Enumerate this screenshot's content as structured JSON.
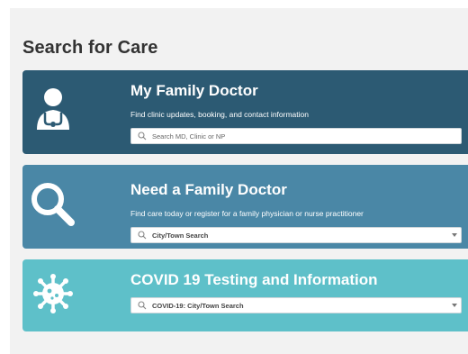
{
  "heading": "Search for Care",
  "cards": [
    {
      "title": "My Family Doctor",
      "subtitle": "Find clinic updates, booking, and contact information",
      "search_placeholder": "Search MD, Clinic or NP",
      "icon": "doctor-icon",
      "color": "#2c5a73"
    },
    {
      "title": "Need a Family Doctor",
      "subtitle": "Find care today or register for a family physician or nurse practitioner",
      "select_value": "City/Town Search",
      "icon": "magnifier-icon",
      "color": "#4a87a6"
    },
    {
      "title": "COVID 19 Testing and Information",
      "select_value": "COVID-19: City/Town Search",
      "icon": "virus-icon",
      "color": "#5ec0c9"
    }
  ]
}
